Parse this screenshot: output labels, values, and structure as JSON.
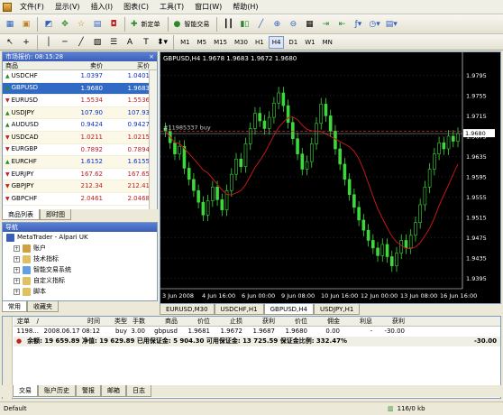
{
  "menu": [
    "文件(F)",
    "显示(V)",
    "插入(I)",
    "图表(C)",
    "工具(T)",
    "窗口(W)",
    "帮助(H)"
  ],
  "toolbar": {
    "new_order": "新定单",
    "expert": "智能交易"
  },
  "timeframes": [
    "M1",
    "M5",
    "M15",
    "M30",
    "H1",
    "H4",
    "D1",
    "W1",
    "MN"
  ],
  "active_timeframe": "H4",
  "market_watch": {
    "title": "市场报价: 08:15:28",
    "col_symbol": "商品",
    "col_bid": "卖价",
    "col_ask": "买价",
    "rows": [
      {
        "symbol": "USDCHF",
        "bid": "1.0397",
        "ask": "1.0401",
        "dir": "up"
      },
      {
        "symbol": "GBPUSD",
        "bid": "1.9680",
        "ask": "1.9683",
        "dir": "up",
        "selected": true
      },
      {
        "symbol": "EURUSD",
        "bid": "1.5534",
        "ask": "1.5536",
        "dir": "down"
      },
      {
        "symbol": "USDJPY",
        "bid": "107.90",
        "ask": "107.93",
        "dir": "up"
      },
      {
        "symbol": "AUDUSD",
        "bid": "0.9424",
        "ask": "0.9427",
        "dir": "up"
      },
      {
        "symbol": "USDCAD",
        "bid": "1.0211",
        "ask": "1.0215",
        "dir": "down"
      },
      {
        "symbol": "EURGBP",
        "bid": "0.7892",
        "ask": "0.7894",
        "dir": "down"
      },
      {
        "symbol": "EURCHF",
        "bid": "1.6152",
        "ask": "1.6155",
        "dir": "up"
      },
      {
        "symbol": "EURJPY",
        "bid": "167.62",
        "ask": "167.65",
        "dir": "down"
      },
      {
        "symbol": "GBPJPY",
        "bid": "212.34",
        "ask": "212.41",
        "dir": "down"
      },
      {
        "symbol": "GBPCHF",
        "bid": "2.0461",
        "ask": "2.0468",
        "dir": "down"
      }
    ],
    "tabs": [
      "商品列表",
      "即时图"
    ]
  },
  "navigator": {
    "title": "导航",
    "root": "MetaTrader - Alpari UK",
    "items": [
      "账户",
      "技术指标",
      "智能交易系统",
      "自定义指标",
      "脚本"
    ],
    "tabs": [
      "常用",
      "收藏夹"
    ]
  },
  "chart": {
    "header": "GBPUSD,H4  1.9678 1.9683 1.9672 1.9680",
    "order_label": "#11985337 buy",
    "current_price": "1.9680",
    "price_labels": [
      "1.9795",
      "1.9755",
      "1.9715",
      "1.9675",
      "1.9635",
      "1.9595",
      "1.9555",
      "1.9515",
      "1.9475",
      "1.9435",
      "1.9395"
    ],
    "time_labels": [
      "3 Jun 2008",
      "4 Jun 16:00",
      "6 Jun 00:00",
      "9 Jun 08:00",
      "10 Jun 16:00",
      "12 Jun 00:00",
      "13 Jun 08:00",
      "16 Jun 16:00"
    ],
    "tabs": [
      "EURUSD,M30",
      "USDCHF,H1",
      "GBPUSD,H4",
      "USDJPY,H1"
    ],
    "active_tab": "GBPUSD,H4"
  },
  "terminal": {
    "headers": [
      "定单",
      "/",
      "时间",
      "类型",
      "手数",
      "商品",
      "价位",
      "止损",
      "获利",
      "价位",
      "佣金",
      "利息",
      "获利"
    ],
    "row": [
      "1198...",
      "2008.06.17 08:12",
      "buy",
      "3.00",
      "gbpusd",
      "1.9681",
      "1.9672",
      "1.9687",
      "1.9680",
      "0.00",
      "-",
      "-30.00"
    ],
    "balance_line": "余额: 19 659.89  净值: 19 629.89  已用保证金: 5 904.30  可用保证金: 13 725.59  保证金比例: 332.47%",
    "balance_total": "-30.00",
    "tabs": [
      "交易",
      "账户历史",
      "警报",
      "邮箱",
      "日志"
    ]
  },
  "status": {
    "left": "Default",
    "traffic": "116/0 kb"
  }
}
